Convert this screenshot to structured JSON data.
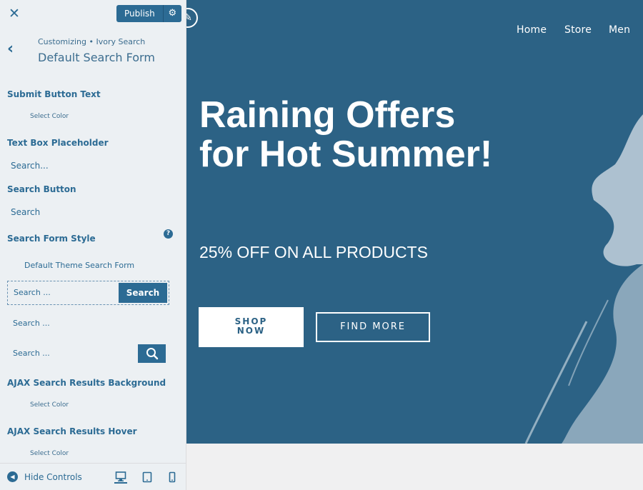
{
  "topbar": {
    "publish_label": "Publish"
  },
  "section": {
    "breadcrumb": "Customizing • Ivory Search",
    "title": "Default Search Form"
  },
  "controls": {
    "submit_button_text_label": "Submit Button Text",
    "select_color": "Select Color",
    "text_box_placeholder_label": "Text Box Placeholder",
    "text_box_placeholder_value": "Search...",
    "search_button_label": "Search Button",
    "search_button_value": "Search",
    "search_form_style_label": "Search Form Style",
    "search_form_style_value": "Default Theme Search Form",
    "style_placeholder": "Search ...",
    "style_button_text": "Search",
    "ajax_bg_label": "AJAX Search Results Background",
    "ajax_hover_label": "AJAX Search Results Hover"
  },
  "footer": {
    "hide_controls": "Hide Controls"
  },
  "preview": {
    "nav": [
      "Home",
      "Store",
      "Men"
    ],
    "headline": "Raining Offers for Hot Summer!",
    "subline": "25% OFF ON ALL PRODUCTS",
    "shop_line1": "SHOP",
    "shop_line2": "NOW",
    "find_more": "FIND MORE"
  },
  "colors": {
    "accent": "#2c6b94",
    "hero_bg": "#2c6285",
    "sidebar_bg": "#ecf0f3"
  }
}
